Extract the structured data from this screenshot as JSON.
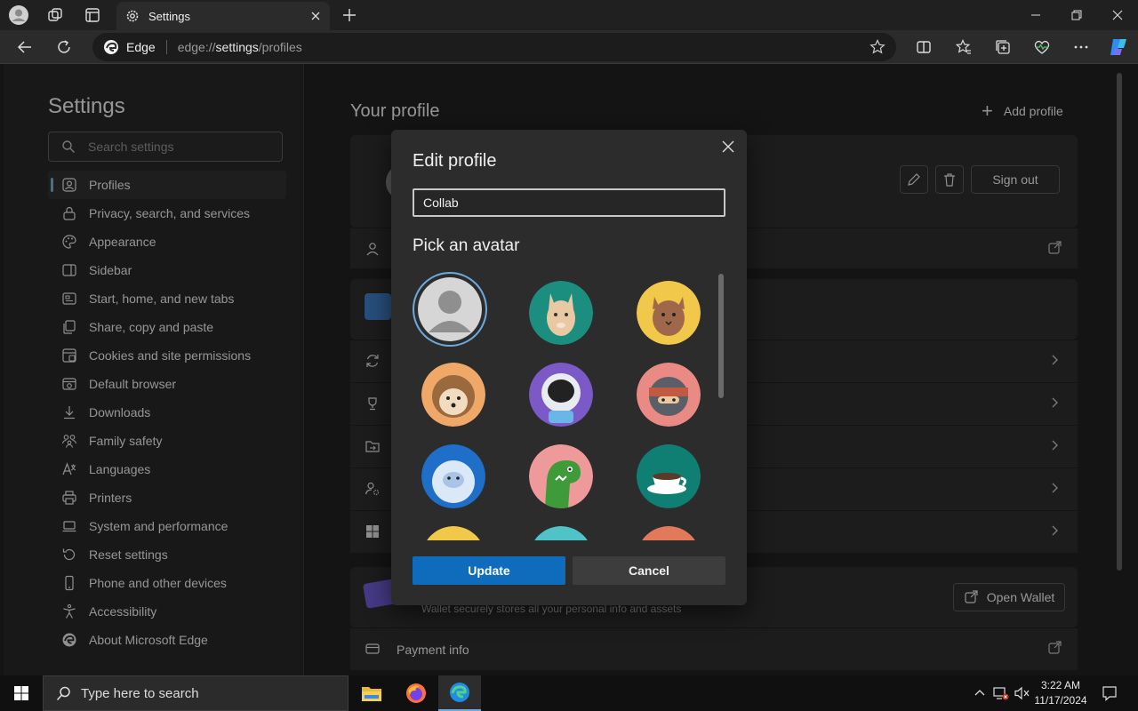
{
  "browser": {
    "tab_title": "Settings",
    "site_name": "Edge",
    "url_scheme": "edge://",
    "url_host": "settings",
    "url_path": "/profiles"
  },
  "sidebar": {
    "title": "Settings",
    "search_placeholder": "Search settings",
    "items": [
      {
        "label": "Profiles",
        "icon": "profile-icon",
        "active": true
      },
      {
        "label": "Privacy, search, and services",
        "icon": "lock-icon"
      },
      {
        "label": "Appearance",
        "icon": "palette-icon"
      },
      {
        "label": "Sidebar",
        "icon": "sidebar-icon"
      },
      {
        "label": "Start, home, and new tabs",
        "icon": "home-icon"
      },
      {
        "label": "Share, copy and paste",
        "icon": "share-icon"
      },
      {
        "label": "Cookies and site permissions",
        "icon": "cookie-icon"
      },
      {
        "label": "Default browser",
        "icon": "browser-icon"
      },
      {
        "label": "Downloads",
        "icon": "download-icon"
      },
      {
        "label": "Family safety",
        "icon": "family-icon"
      },
      {
        "label": "Languages",
        "icon": "language-icon"
      },
      {
        "label": "Printers",
        "icon": "printer-icon"
      },
      {
        "label": "System and performance",
        "icon": "laptop-icon"
      },
      {
        "label": "Reset settings",
        "icon": "reset-icon"
      },
      {
        "label": "Phone and other devices",
        "icon": "phone-icon"
      },
      {
        "label": "Accessibility",
        "icon": "accessibility-icon"
      },
      {
        "label": "About Microsoft Edge",
        "icon": "edge-icon"
      }
    ]
  },
  "main": {
    "heading": "Your profile",
    "add_profile": "Add profile",
    "sign_out": "Sign out",
    "open_wallet": "Open Wallet",
    "wallet_desc": "Wallet securely stores all your personal info and assets",
    "payment_info": "Payment info"
  },
  "dialog": {
    "title": "Edit profile",
    "name_value": "Collab",
    "pick_avatar": "Pick an avatar",
    "update": "Update",
    "cancel": "Cancel"
  },
  "taskbar": {
    "search_placeholder": "Type here to search",
    "time": "3:22 AM",
    "date": "11/17/2024"
  },
  "colors": {
    "accent": "#0f6cbd",
    "selection_ring": "#6fa8dc"
  }
}
